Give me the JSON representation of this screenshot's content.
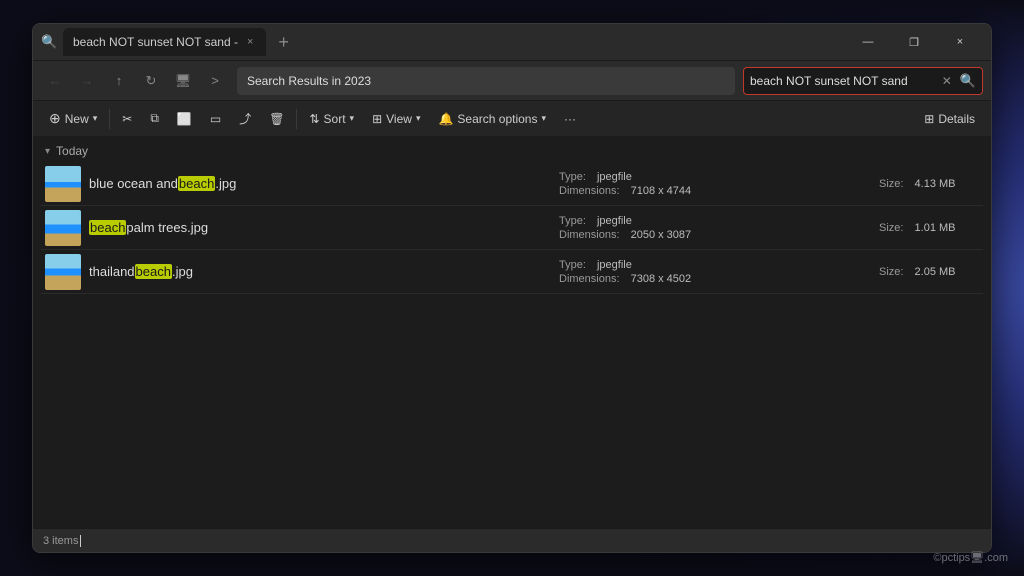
{
  "wallpaper": {
    "description": "dark blue radial gradient"
  },
  "window": {
    "tab_title": "beach NOT sunset NOT sand -",
    "tab_icon": "🔍"
  },
  "title_bar": {
    "tab_label": "beach NOT sunset NOT sand -",
    "close_label": "×",
    "minimize_label": "—",
    "maximize_label": "❐",
    "new_tab_label": "+"
  },
  "nav_bar": {
    "back_label": "←",
    "forward_label": "→",
    "up_label": "↑",
    "refresh_label": "↻",
    "monitor_label": "🖥",
    "chevron_label": ">",
    "breadcrumb": "Search Results in 2023",
    "search_value": "beach NOT sunset NOT sand",
    "search_placeholder": "beach NOT sunset NOT sand"
  },
  "toolbar": {
    "new_label": "New",
    "cut_label": "✂",
    "copy_label": "⧉",
    "paste_label": "⬜",
    "rename_label": "▭",
    "share_label": "⤴",
    "delete_label": "🗑",
    "sort_label": "Sort",
    "view_label": "View",
    "search_options_label": "Search options",
    "more_label": "···",
    "details_label": "Details"
  },
  "content": {
    "group_label": "Today",
    "files": [
      {
        "id": 1,
        "name_prefix": "blue ocean and ",
        "name_highlight": "beach",
        "name_suffix": ".jpg",
        "type_label": "Type:",
        "type_value": "jpegfile",
        "dimensions_label": "Dimensions:",
        "dimensions_value": "7108 x 4744",
        "size_label": "Size:",
        "size_value": "4.13 MB",
        "thumb_class": "thumb-beach1"
      },
      {
        "id": 2,
        "name_prefix": "",
        "name_highlight": "beach",
        "name_suffix": " palm trees.jpg",
        "type_label": "Type:",
        "type_value": "jpegfile",
        "dimensions_label": "Dimensions:",
        "dimensions_value": "2050 x 3087",
        "size_label": "Size:",
        "size_value": "1.01 MB",
        "thumb_class": "thumb-beach2"
      },
      {
        "id": 3,
        "name_prefix": "thailand ",
        "name_highlight": "beach",
        "name_suffix": ".jpg",
        "type_label": "Type:",
        "type_value": "jpegfile",
        "dimensions_label": "Dimensions:",
        "dimensions_value": "7308 x 4502",
        "size_label": "Size:",
        "size_value": "2.05 MB",
        "thumb_class": "thumb-beach3"
      }
    ]
  },
  "status_bar": {
    "count_label": "3 items"
  },
  "watermark": "©pctips🖥.com"
}
